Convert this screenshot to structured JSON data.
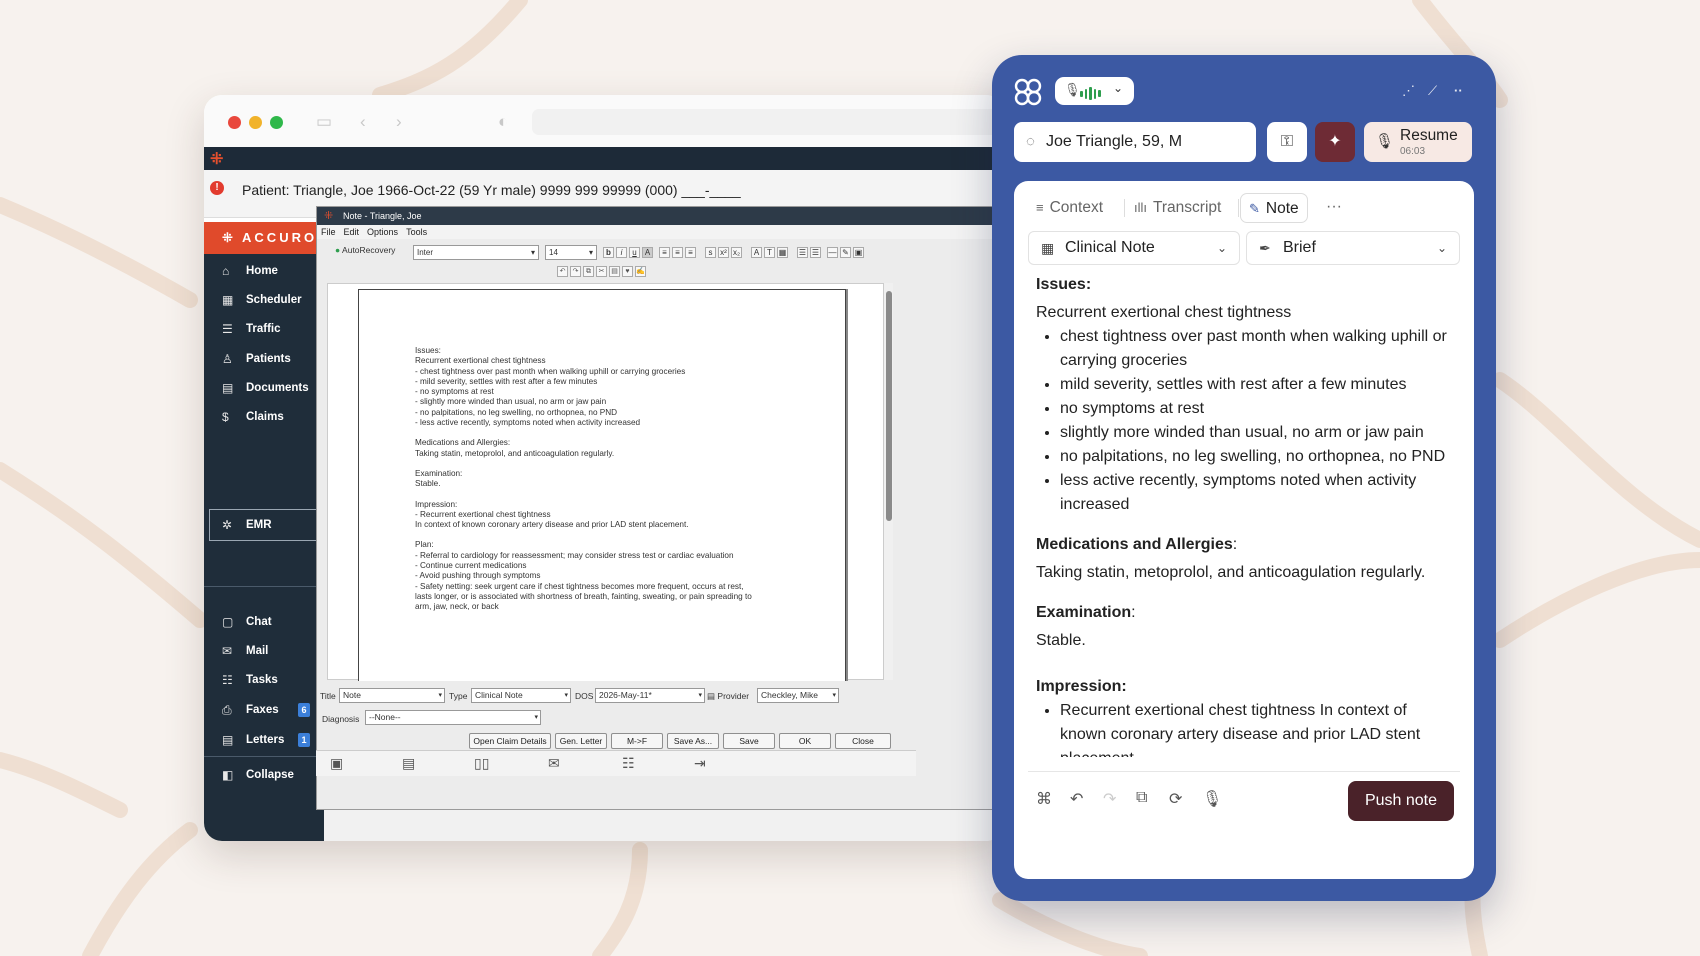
{
  "colors": {
    "background": "#f7f2ee",
    "panel_blue": "#3c59a3",
    "accuro_orange": "#e04a2b",
    "sidebar_dark": "#1f2d3a",
    "push_button": "#4a2229",
    "magic_button": "#6e2b35",
    "resume_button": "#f7e9e4",
    "waveform_green": "#2e9e4e"
  },
  "accuro": {
    "patient_header": "Patient: Triangle, Joe 1966-Oct-22 (59 Yr male) 9999 999 99999 (000) ___-____",
    "brand": "ACCURO",
    "nav_top": [
      {
        "label": "Home",
        "icon": "home-icon"
      },
      {
        "label": "Scheduler",
        "icon": "calendar-icon"
      },
      {
        "label": "Traffic",
        "icon": "traffic-icon"
      },
      {
        "label": "Patients",
        "icon": "person-icon"
      },
      {
        "label": "Documents",
        "icon": "document-icon"
      },
      {
        "label": "Claims",
        "icon": "dollar-icon"
      },
      {
        "label": "EMR",
        "icon": "gear-icon"
      }
    ],
    "nav_bottom": [
      {
        "label": "Chat",
        "icon": "chat-icon"
      },
      {
        "label": "Mail",
        "icon": "mail-icon"
      },
      {
        "label": "Tasks",
        "icon": "tasks-icon"
      },
      {
        "label": "Faxes",
        "icon": "fax-icon",
        "badge": "6"
      },
      {
        "label": "Letters",
        "icon": "letter-icon",
        "badge": "1"
      }
    ],
    "collapse_label": "Collapse"
  },
  "note_dialog": {
    "title": "Note - Triangle, Joe",
    "menu": [
      "File",
      "Edit",
      "Options",
      "Tools"
    ],
    "autorecovery": "AutoRecovery",
    "font": "Inter",
    "font_size": "14",
    "doc_lines": [
      "Issues:",
      "Recurrent exertional chest tightness",
      "- chest tightness over past month when walking uphill or carrying groceries",
      "- mild severity, settles with rest after a few minutes",
      "- no symptoms at rest",
      "- slightly more winded than usual, no arm or jaw pain",
      "- no palpitations, no leg swelling, no orthopnea, no PND",
      "- less active recently, symptoms noted when activity increased",
      "",
      "Medications and Allergies:",
      "Taking statin, metoprolol, and anticoagulation regularly.",
      "",
      "Examination:",
      "Stable.",
      "",
      "Impression:",
      "- Recurrent exertional chest tightness",
      "In context of known coronary artery disease and prior LAD stent placement.",
      "",
      "Plan:",
      "- Referral to cardiology for reassessment; may consider stress test or cardiac evaluation",
      "- Continue current medications",
      "- Avoid pushing through symptoms",
      "- Safety netting: seek urgent care if chest tightness becomes more frequent, occurs at rest,",
      "lasts longer, or is associated with shortness of breath, fainting, sweating, or pain spreading to",
      "arm, jaw, neck, or back"
    ],
    "form": {
      "title_label": "Title",
      "title_value": "Note",
      "type_label": "Type",
      "type_value": "Clinical Note",
      "dos_label": "DOS",
      "dos_value": "2026-May-11*",
      "provider_label": "Provider",
      "provider_value": "Checkley, Mike",
      "diagnosis_label": "Diagnosis",
      "diagnosis_value": "--None--"
    },
    "buttons": [
      "Open Claim Details",
      "Gen. Letter",
      "M->F",
      "Save As...",
      "Save",
      "OK",
      "Close"
    ]
  },
  "scribe": {
    "patient": "Joe Triangle, 59, M",
    "resume_label": "Resume",
    "resume_time": "06:03",
    "tabs": [
      {
        "label": "Context",
        "icon": "list-icon"
      },
      {
        "label": "Transcript",
        "icon": "waveform-icon"
      },
      {
        "label": "Note",
        "icon": "pen-icon"
      }
    ],
    "template_select": "Clinical Note",
    "style_select": "Brief",
    "note": {
      "issues_heading": "Issues",
      "issues_title": "Recurrent exertional chest tightness",
      "issues_bullets": [
        "chest tightness over past month when walking uphill or carrying groceries",
        "mild severity, settles with rest after a few minutes",
        "no symptoms at rest",
        "slightly more winded than usual, no arm or jaw pain",
        "no palpitations, no leg swelling, no orthopnea, no PND",
        "less active recently, symptoms noted when activity increased"
      ],
      "meds_heading": "Medications and Allergies",
      "meds_text": "Taking statin, metoprolol, and anticoagulation regularly.",
      "exam_heading": "Examination",
      "exam_text": "Stable.",
      "impression_heading": "Impression:",
      "impression_bullets": [
        "Recurrent exertional chest tightness In context of known coronary artery disease and prior LAD stent placement."
      ]
    },
    "push_label": "Push note"
  }
}
